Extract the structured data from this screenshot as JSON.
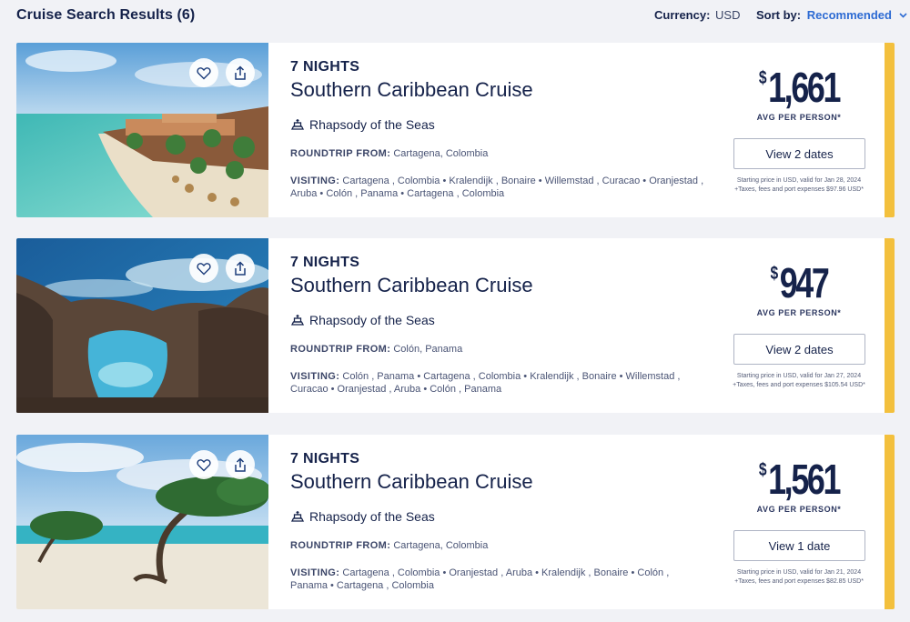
{
  "header": {
    "title": "Cruise Search Results (6)",
    "currency_label": "Currency:",
    "currency_value": "USD",
    "sort_label": "Sort by:",
    "sort_value": "Recommended"
  },
  "colors": {
    "accent": "#f3c03d",
    "navy": "#15224a",
    "link": "#2d6bd3"
  },
  "cards": [
    {
      "nights": "7 NIGHTS",
      "name": "Southern Caribbean Cruise",
      "ship": "Rhapsody of the Seas",
      "roundtrip_label": "ROUNDTRIP FROM:",
      "roundtrip_value": "Cartagena, Colombia",
      "visiting_label": "VISITING:",
      "visiting_value": "Cartagena , Colombia • Kralendijk , Bonaire • Willemstad , Curacao • Oranjestad , Aruba • Colón , Panama • Cartagena , Colombia",
      "currency_symbol": "$",
      "price": "1,661",
      "avg_label": "AVG PER PERSON*",
      "button_label": "View 2 dates",
      "fine_line1": "Starting price in USD, valid for Jan 28, 2024",
      "fine_line2": "+Taxes, fees and port expenses $97.96 USD*",
      "icon_fav": "heart-icon",
      "icon_share": "share-icon"
    },
    {
      "nights": "7 NIGHTS",
      "name": "Southern Caribbean Cruise",
      "ship": "Rhapsody of the Seas",
      "roundtrip_label": "ROUNDTRIP FROM:",
      "roundtrip_value": "Colón, Panama",
      "visiting_label": "VISITING:",
      "visiting_value": "Colón , Panama • Cartagena , Colombia • Kralendijk , Bonaire • Willemstad , Curacao • Oranjestad , Aruba • Colón , Panama",
      "currency_symbol": "$",
      "price": "947",
      "avg_label": "AVG PER PERSON*",
      "button_label": "View 2 dates",
      "fine_line1": "Starting price in USD, valid for Jan 27, 2024",
      "fine_line2": "+Taxes, fees and port expenses $105.54 USD*",
      "icon_fav": "heart-icon",
      "icon_share": "share-icon"
    },
    {
      "nights": "7 NIGHTS",
      "name": "Southern Caribbean Cruise",
      "ship": "Rhapsody of the Seas",
      "roundtrip_label": "ROUNDTRIP FROM:",
      "roundtrip_value": "Cartagena, Colombia",
      "visiting_label": "VISITING:",
      "visiting_value": "Cartagena , Colombia • Oranjestad , Aruba • Kralendijk , Bonaire • Colón , Panama • Cartagena , Colombia",
      "currency_symbol": "$",
      "price": "1,561",
      "avg_label": "AVG PER PERSON*",
      "button_label": "View 1 date",
      "fine_line1": "Starting price in USD, valid for Jan 21, 2024",
      "fine_line2": "+Taxes, fees and port expenses $82.85 USD*",
      "icon_fav": "heart-icon",
      "icon_share": "share-icon"
    }
  ]
}
